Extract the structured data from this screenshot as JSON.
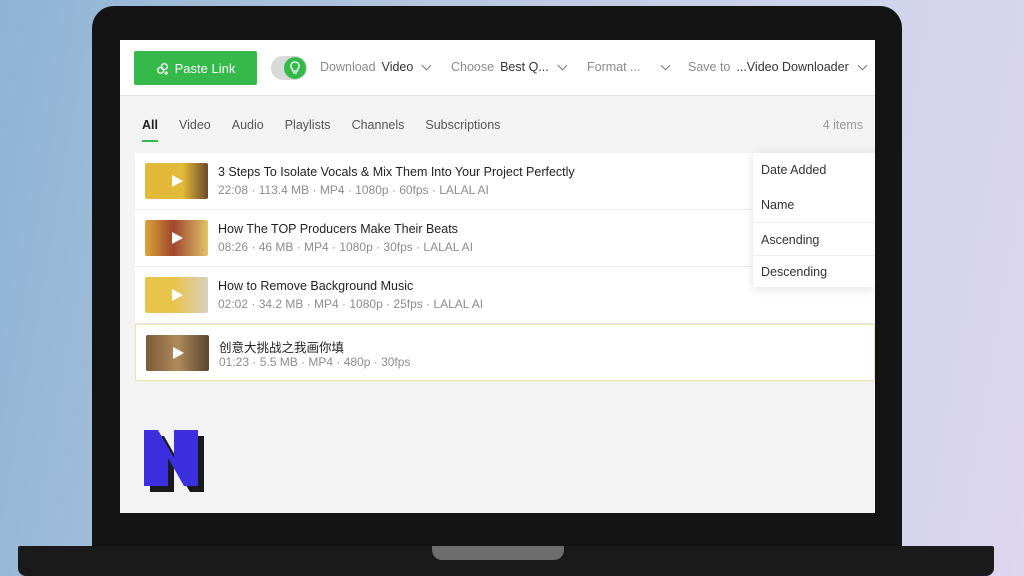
{
  "toolbar": {
    "paste_label": "Paste Link",
    "download_label": "Download",
    "download_value": "Video",
    "choose_label": "Choose",
    "choose_value": "Best Q...",
    "format_label": "Format ...",
    "save_label": "Save to",
    "save_value": "...Video Downloader"
  },
  "tabs": [
    "All",
    "Video",
    "Audio",
    "Playlists",
    "Channels",
    "Subscriptions"
  ],
  "active_tab": "All",
  "items_count": "4 items",
  "items": [
    {
      "title": "3 Steps To Isolate Vocals & Mix Them Into Your Project Perfectly",
      "meta": "22:08 · 113.4 MB · MP4 · 1080p · 60fps · LALAL AI",
      "thumb_color": "#e3b93a"
    },
    {
      "title": "How The TOP Producers Make Their Beats",
      "meta": "08:26 · 46 MB · MP4 · 1080p · 30fps · LALAL AI",
      "thumb_color": "#c98a3a"
    },
    {
      "title": "How to Remove Background Music",
      "meta": "02:02 · 34.2 MB · MP4 · 1080p · 25fps · LALAL AI",
      "thumb_color": "#e8c44a"
    },
    {
      "title": "创意大挑战之我画你填",
      "meta": "01:23 · 5.5 MB · MP4 · 480p · 30fps",
      "thumb_color": "#8a6a4a"
    }
  ],
  "sort_menu": [
    "Date Added",
    "Name",
    "Ascending",
    "Descending"
  ],
  "colors": {
    "accent": "#34b94a",
    "logo": "#3b2fe0"
  },
  "icons": {
    "paste": "link-plus-icon",
    "toggle": "lightbulb-icon",
    "play": "play-icon"
  }
}
